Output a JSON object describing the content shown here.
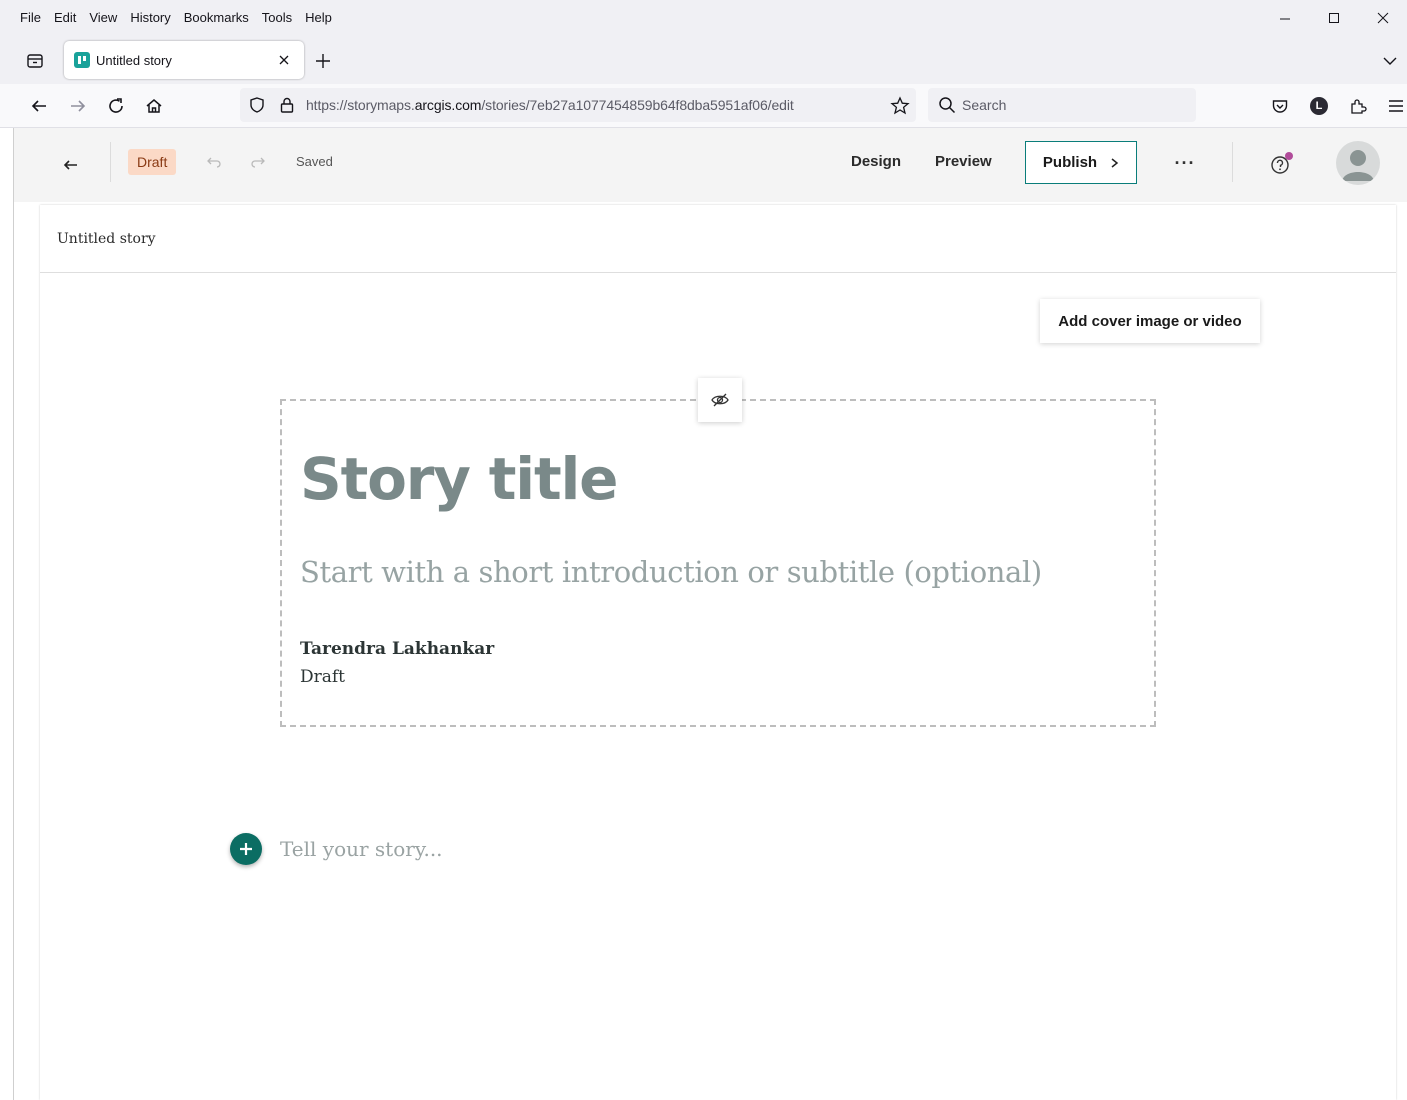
{
  "browser": {
    "menu": [
      "File",
      "Edit",
      "View",
      "History",
      "Bookmarks",
      "Tools",
      "Help"
    ],
    "tab": {
      "title": "Untitled story"
    },
    "url": {
      "prefix": "https://storymaps.",
      "domain": "arcgis.com",
      "path": "/stories/7eb27a1077454859b64f8dba5951af06/edit"
    },
    "search": {
      "placeholder": "Search"
    },
    "account_initial": "L"
  },
  "header": {
    "badge": "Draft",
    "save_status": "Saved",
    "design_label": "Design",
    "preview_label": "Preview",
    "publish_label": "Publish",
    "more_label": "···"
  },
  "story": {
    "nav_title": "Untitled story",
    "cover_button": "Add cover image or video",
    "title_placeholder": "Story title",
    "subtitle_placeholder": "Start with a short introduction or subtitle (optional)",
    "author": "Tarendra Lakhankar",
    "status": "Draft",
    "body_placeholder": "Tell your story..."
  },
  "colors": {
    "accent": "#0b6d63",
    "publish_border": "#0a7d7a",
    "draft_badge_bg": "#fbd9c6",
    "title_placeholder": "#7a8989"
  }
}
